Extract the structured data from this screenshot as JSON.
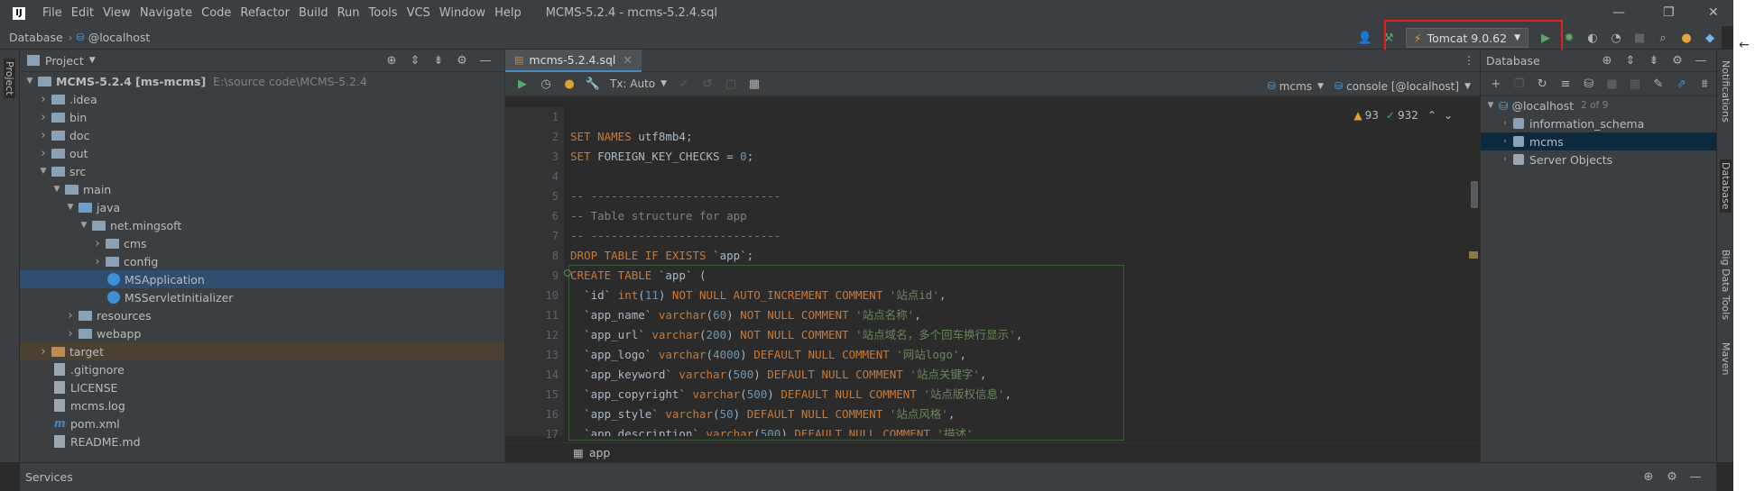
{
  "window": {
    "title": "MCMS-5.2.4 - mcms-5.2.4.sql"
  },
  "menu": [
    "File",
    "Edit",
    "View",
    "Navigate",
    "Code",
    "Refactor",
    "Build",
    "Run",
    "Tools",
    "VCS",
    "Window",
    "Help"
  ],
  "breadcrumb": {
    "root": "Database",
    "host": "@localhost"
  },
  "run_config": {
    "label": "Tomcat 9.0.62"
  },
  "project_panel": {
    "title": "Project",
    "tree": [
      {
        "label": "MCMS-5.2.4 [ms-mcms]",
        "path": "E:\\source code\\MCMS-5.2.4",
        "depth": 0,
        "open": true,
        "kind": "folder"
      },
      {
        "label": ".idea",
        "depth": 1,
        "open": false,
        "kind": "folder"
      },
      {
        "label": "bin",
        "depth": 1,
        "open": false,
        "kind": "folder"
      },
      {
        "label": "doc",
        "depth": 1,
        "open": false,
        "kind": "folder"
      },
      {
        "label": "out",
        "depth": 1,
        "open": false,
        "kind": "folder"
      },
      {
        "label": "src",
        "depth": 1,
        "open": true,
        "kind": "folder"
      },
      {
        "label": "main",
        "depth": 2,
        "open": true,
        "kind": "folder"
      },
      {
        "label": "java",
        "depth": 3,
        "open": true,
        "kind": "folder-blue"
      },
      {
        "label": "net.mingsoft",
        "depth": 4,
        "open": true,
        "kind": "folder"
      },
      {
        "label": "cms",
        "depth": 5,
        "open": false,
        "kind": "folder"
      },
      {
        "label": "config",
        "depth": 5,
        "open": false,
        "kind": "folder"
      },
      {
        "label": "MSApplication",
        "depth": 5,
        "leaf": true,
        "kind": "class",
        "selected": true
      },
      {
        "label": "MSServletInitializer",
        "depth": 5,
        "leaf": true,
        "kind": "class"
      },
      {
        "label": "resources",
        "depth": 3,
        "open": false,
        "kind": "folder"
      },
      {
        "label": "webapp",
        "depth": 3,
        "open": false,
        "kind": "folder"
      },
      {
        "label": "target",
        "depth": 1,
        "open": false,
        "kind": "folder-orange",
        "excluded": true
      },
      {
        "label": ".gitignore",
        "depth": 1,
        "leaf": true,
        "kind": "file"
      },
      {
        "label": "LICENSE",
        "depth": 1,
        "leaf": true,
        "kind": "file"
      },
      {
        "label": "mcms.log",
        "depth": 1,
        "leaf": true,
        "kind": "file"
      },
      {
        "label": "pom.xml",
        "depth": 1,
        "leaf": true,
        "kind": "maven"
      },
      {
        "label": "README.md",
        "depth": 1,
        "leaf": true,
        "kind": "file"
      }
    ]
  },
  "editor": {
    "tab": "mcms-5.2.4.sql",
    "tx_mode": "Tx: Auto",
    "schema": "mcms",
    "console": "console [@localhost]",
    "warnings": "93",
    "checks": "932",
    "line_numbers": [
      "1",
      "2",
      "3",
      "4",
      "5",
      "6",
      "7",
      "8",
      "9",
      "10",
      "11",
      "12",
      "13",
      "14",
      "15",
      "16",
      "17"
    ],
    "status_item": "app"
  },
  "database_panel": {
    "title": "Database",
    "host": "@localhost",
    "host_count": "2 of 9",
    "items": [
      "information_schema",
      "mcms",
      "Server Objects"
    ]
  },
  "side_labels": {
    "left": "Project",
    "right1": "Notifications",
    "right2": "Database",
    "right3": "Big Data Tools",
    "right4": "Maven"
  },
  "bottom": {
    "services": "Services"
  },
  "colors": {
    "accent": "#4a88c7",
    "highlight_box": "#e81e1e",
    "selection": "#2f4d6e"
  }
}
